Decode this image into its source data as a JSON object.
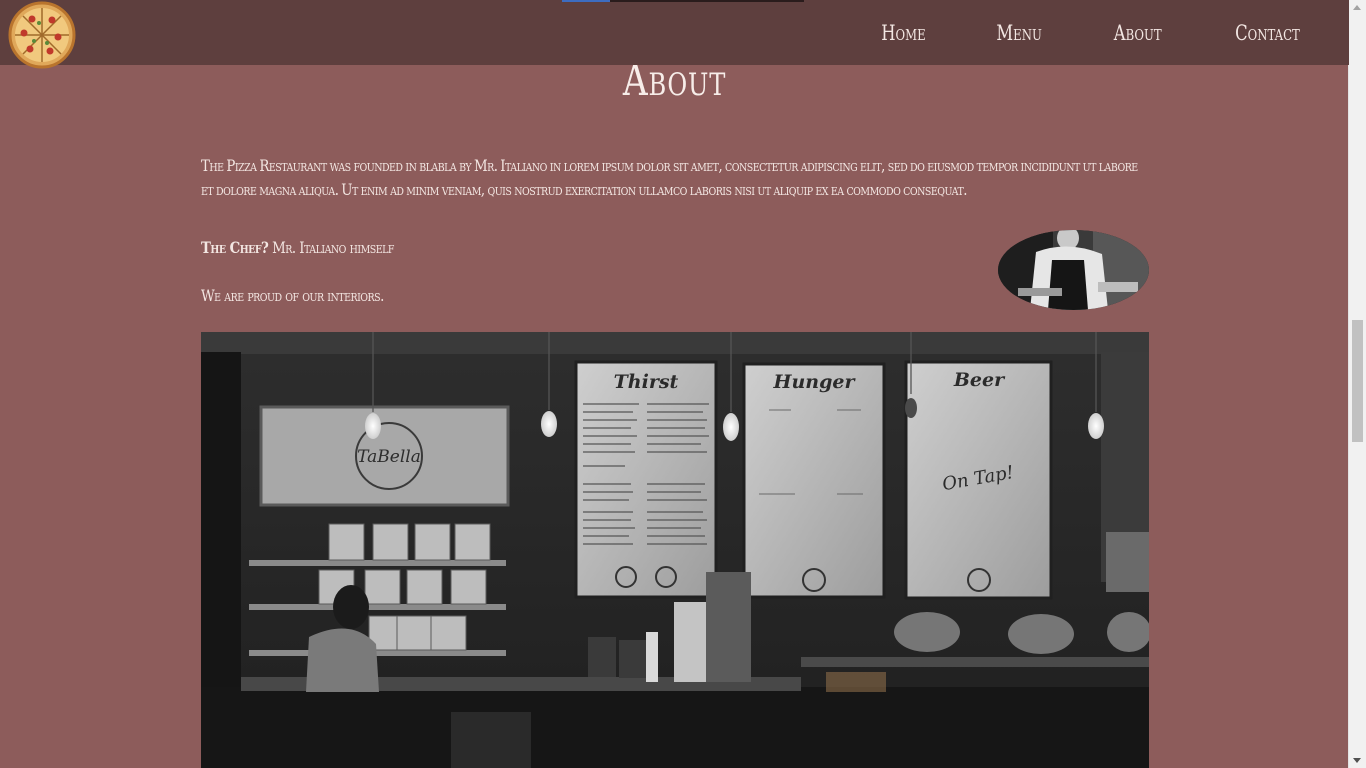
{
  "nav": {
    "links": [
      "Home",
      "Menu",
      "About",
      "Contact"
    ],
    "progress_fraction": 0.2
  },
  "about": {
    "title": "About",
    "intro": "The Pizza Restaurant was founded in blabla by Mr. Italiano in lorem ipsum dolor sit amet, consectetur adipiscing elit, sed do eiusmod tempor incididunt ut labore et dolore magna aliqua. Ut enim ad minim veniam, quis nostrud exercitation ullamco laboris nisi ut aliquip ex ea commodo consequat.",
    "chef_label": "The Chef?",
    "chef_value": "Mr. Italiano himself",
    "interiors_text": "We are proud of our interiors.",
    "menu_boards": [
      "Thirst",
      "Hunger",
      "Beer"
    ],
    "on_tap": "On Tap!",
    "wall_sign": "TaBella"
  },
  "colors": {
    "page_bg": "#8d5c5b",
    "navbar_bg": "#5e3f3e",
    "text": "#f3e6e2",
    "progress_fill": "#3d6cc0"
  },
  "icons": {
    "logo": "pizza-logo-icon",
    "scroll_up": "scroll-up-arrow-icon",
    "scroll_down": "scroll-down-arrow-icon"
  }
}
